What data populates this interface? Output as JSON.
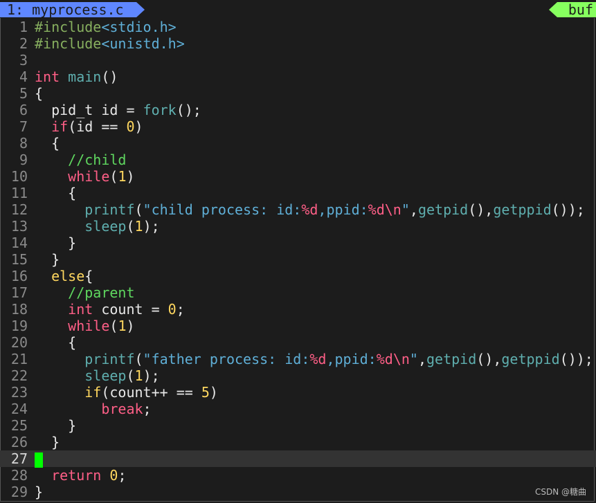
{
  "tabline": {
    "active_tab": "1: myprocess.c",
    "buffer_label": "buf"
  },
  "line_numbers": [
    "1",
    "2",
    "3",
    "4",
    "5",
    "6",
    "7",
    "8",
    "9",
    "10",
    "11",
    "12",
    "13",
    "14",
    "15",
    "16",
    "17",
    "18",
    "19",
    "20",
    "21",
    "22",
    "23",
    "24",
    "25",
    "26",
    "27",
    "28",
    "29"
  ],
  "code": {
    "l1": [
      "#include",
      "<stdio.h>"
    ],
    "l2": [
      "#include",
      "<unistd.h>"
    ],
    "l4": [
      "int",
      "main",
      "()"
    ],
    "l5": [
      "{"
    ],
    "l6": [
      "pid_t id = ",
      "fork",
      "();"
    ],
    "l7": [
      "if",
      "(id == ",
      "0",
      ")"
    ],
    "l8": [
      "{"
    ],
    "l9": [
      "//child"
    ],
    "l10": [
      "while",
      "(",
      "1",
      ")"
    ],
    "l11": [
      "{"
    ],
    "l12": [
      "printf",
      "(",
      "\"child process: id:",
      "%d",
      ",ppid:",
      "%d",
      "\\n",
      "\"",
      ",",
      "getpid",
      "(),",
      "getppid",
      "());"
    ],
    "l13": [
      "sleep",
      "(",
      "1",
      ");"
    ],
    "l14": [
      "}"
    ],
    "l15": [
      "}"
    ],
    "l16": [
      "else",
      "{"
    ],
    "l17": [
      "//parent"
    ],
    "l18": [
      "int",
      " count = ",
      "0",
      ";"
    ],
    "l19": [
      "while",
      "(",
      "1",
      ")"
    ],
    "l20": [
      "{"
    ],
    "l21": [
      "printf",
      "(",
      "\"father process: id:",
      "%d",
      ",ppid:",
      "%d",
      "\\n",
      "\"",
      ",",
      "getpid",
      "(),",
      "getppid",
      "());"
    ],
    "l22": [
      "sleep",
      "(",
      "1",
      ");"
    ],
    "l23": [
      "if",
      "(count++ == ",
      "5",
      ")"
    ],
    "l24": [
      "break",
      ";"
    ],
    "l25": [
      "}"
    ],
    "l26": [
      "}"
    ],
    "l28": [
      "return",
      " ",
      "0",
      ";"
    ],
    "l29": [
      "}"
    ]
  },
  "watermark": "CSDN @糖曲",
  "colors": {
    "tab_active": "#5f87ff",
    "buffer_tab": "#87ff5f",
    "cursor": "#00ff00",
    "keyword": "#ff5f87",
    "function": "#5fafaf",
    "number": "#ffd75f",
    "comment": "#5fd75f"
  }
}
